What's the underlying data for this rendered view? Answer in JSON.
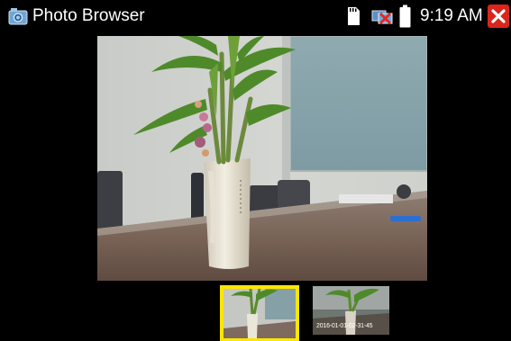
{
  "app": {
    "title": "Photo Browser",
    "icon": "camera-icon"
  },
  "status_bar": {
    "time": "9:19 AM",
    "icons": [
      "sd-card-icon",
      "network-disconnected-icon",
      "battery-icon"
    ]
  },
  "window_controls": {
    "close_icon": "close-icon",
    "close_color": "#d9261c"
  },
  "photo_viewer": {
    "subject": "lucky bamboo plant in white vase on conference table"
  },
  "thumbnails": [
    {
      "caption": "",
      "selected": true
    },
    {
      "caption": "2016-01-01-02-31-45",
      "selected": false
    }
  ],
  "colors": {
    "background": "#000000",
    "selection_border": "#ffe600",
    "text": "#ffffff"
  }
}
